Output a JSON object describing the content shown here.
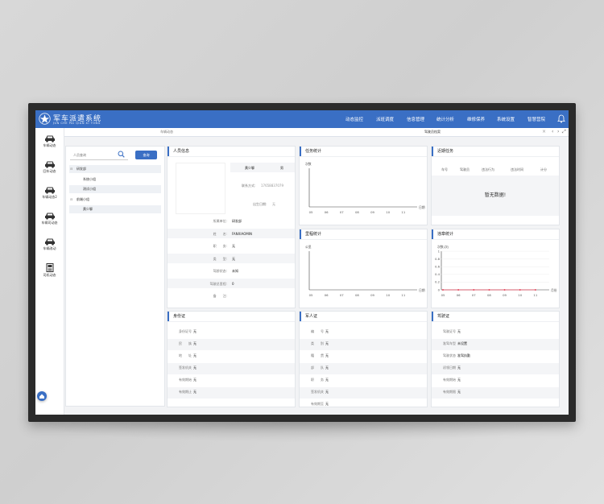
{
  "app": {
    "title": "军车派遣系统",
    "subtitle": "JUN CHE PAI QIAN XI TONG"
  },
  "nav": [
    "动态监控",
    "派班调度",
    "信息管理",
    "统计分析",
    "维修保养",
    "系统设置",
    "智慧营院"
  ],
  "tabs": {
    "tab1": "车辆动态",
    "tab2": "驾驶员档案",
    "close": "×",
    "controls": [
      "‹",
      "›",
      "⤢"
    ]
  },
  "sidebar": [
    {
      "label": "车辆动态",
      "icon": "car-icon"
    },
    {
      "label": "回车动态",
      "icon": "car-return-icon"
    },
    {
      "label": "车辆动态2",
      "icon": "car-icon"
    },
    {
      "label": "车辆司动态",
      "icon": "car-icon"
    },
    {
      "label": "车辆改动",
      "icon": "car-icon"
    },
    {
      "label": "司机动态",
      "icon": "driver-icon"
    }
  ],
  "left_panel": {
    "search_placeholder": "人员查询",
    "search_button": "查询",
    "tree": [
      {
        "label": "研发部",
        "level": 0,
        "toggle": "⊟",
        "shaded": true
      },
      {
        "label": "系统小组",
        "level": 1,
        "toggle": "",
        "shaded": false
      },
      {
        "label": "测试小组",
        "level": 1,
        "toggle": "",
        "shaded": true
      },
      {
        "label": "前端小组",
        "level": 0,
        "toggle": "⊟",
        "shaded": false
      },
      {
        "label": "黄少聊",
        "level": 1,
        "toggle": "",
        "shaded": true
      }
    ]
  },
  "person": {
    "title": "人员信息",
    "name": "黄少聊",
    "gender": "男",
    "phone_label": "联系方式:",
    "phone": "17658837079",
    "birth_label": "出生日期:",
    "birth": "无",
    "fields": [
      {
        "label": "所属单位:",
        "value": "研发部"
      },
      {
        "label": "姓　　名:",
        "value": "FANXIAOMIN"
      },
      {
        "label": "职　　务:",
        "value": "无"
      },
      {
        "label": "类　　型:",
        "value": "无"
      },
      {
        "label": "驾龄状态:",
        "value": "未知"
      },
      {
        "label": "驾驶总里程:",
        "value": "0"
      },
      {
        "label": "备　　注:",
        "value": ""
      }
    ]
  },
  "task_stats": {
    "title": "任务统计",
    "yunit": "次数",
    "xunit": "日期"
  },
  "recent_tasks": {
    "title": "近期任务",
    "columns": [
      "车号",
      "驾驶员",
      "违法行为",
      "违法时间",
      "计分"
    ],
    "empty": "暂无数据!"
  },
  "mileage": {
    "title": "里程统计",
    "yunit": "公里",
    "xunit": "日期"
  },
  "violation": {
    "title": "违章统计",
    "yunit": "次数(次)",
    "xunit": "月份"
  },
  "chart_data": [
    {
      "type": "line",
      "name": "task_stats",
      "categories": [
        "05",
        "06",
        "07",
        "08",
        "09",
        "10",
        "11"
      ],
      "series": [],
      "ylabel": "次数",
      "xlabel": "日期"
    },
    {
      "type": "line",
      "name": "mileage",
      "categories": [
        "05",
        "06",
        "07",
        "08",
        "09",
        "10",
        "11"
      ],
      "series": [],
      "ylabel": "公里",
      "xlabel": "日期"
    },
    {
      "type": "line",
      "name": "violation",
      "categories": [
        "05",
        "06",
        "07",
        "08",
        "09",
        "10",
        "11"
      ],
      "yticks": [
        "1",
        "0.8",
        "0.6",
        "0.4",
        "0.2",
        "0"
      ],
      "ylim": [
        0,
        1
      ],
      "series": [
        {
          "values": [
            0,
            0,
            0,
            0,
            0,
            0,
            0
          ],
          "color": "#e84a5f"
        }
      ],
      "ylabel": "次数(次)",
      "xlabel": "月份",
      "grid": true
    }
  ],
  "id_card": {
    "title": "身份证",
    "fields": [
      {
        "label": "身份证号",
        "value": "无"
      },
      {
        "label": "民　　族",
        "value": "无"
      },
      {
        "label": "地　　址",
        "value": "无"
      },
      {
        "label": "签发机关",
        "value": "无"
      },
      {
        "label": "有效期始",
        "value": "无"
      },
      {
        "label": "有效期止",
        "value": "无"
      }
    ]
  },
  "military_card": {
    "title": "军人证",
    "fields": [
      {
        "label": "编　　号",
        "value": "无"
      },
      {
        "label": "类　　别",
        "value": "无"
      },
      {
        "label": "籍　　贯",
        "value": "无"
      },
      {
        "label": "部　　队",
        "value": "无"
      },
      {
        "label": "职　　务",
        "value": "无"
      },
      {
        "label": "签发机关",
        "value": "无"
      },
      {
        "label": "有效期至",
        "value": "无"
      }
    ]
  },
  "license": {
    "title": "驾驶证",
    "fields": [
      {
        "label": "驾驶证号",
        "value": "无"
      },
      {
        "label": "准驾车型",
        "value": "未设置"
      },
      {
        "label": "驾驶状态",
        "value": "准驾执勤"
      },
      {
        "label": "初领日期",
        "value": "无"
      },
      {
        "label": "有效期始",
        "value": "无"
      },
      {
        "label": "有效期限",
        "value": "无"
      }
    ]
  },
  "colors": {
    "primary": "#3a6fc4",
    "violation_line": "#e84a5f"
  }
}
